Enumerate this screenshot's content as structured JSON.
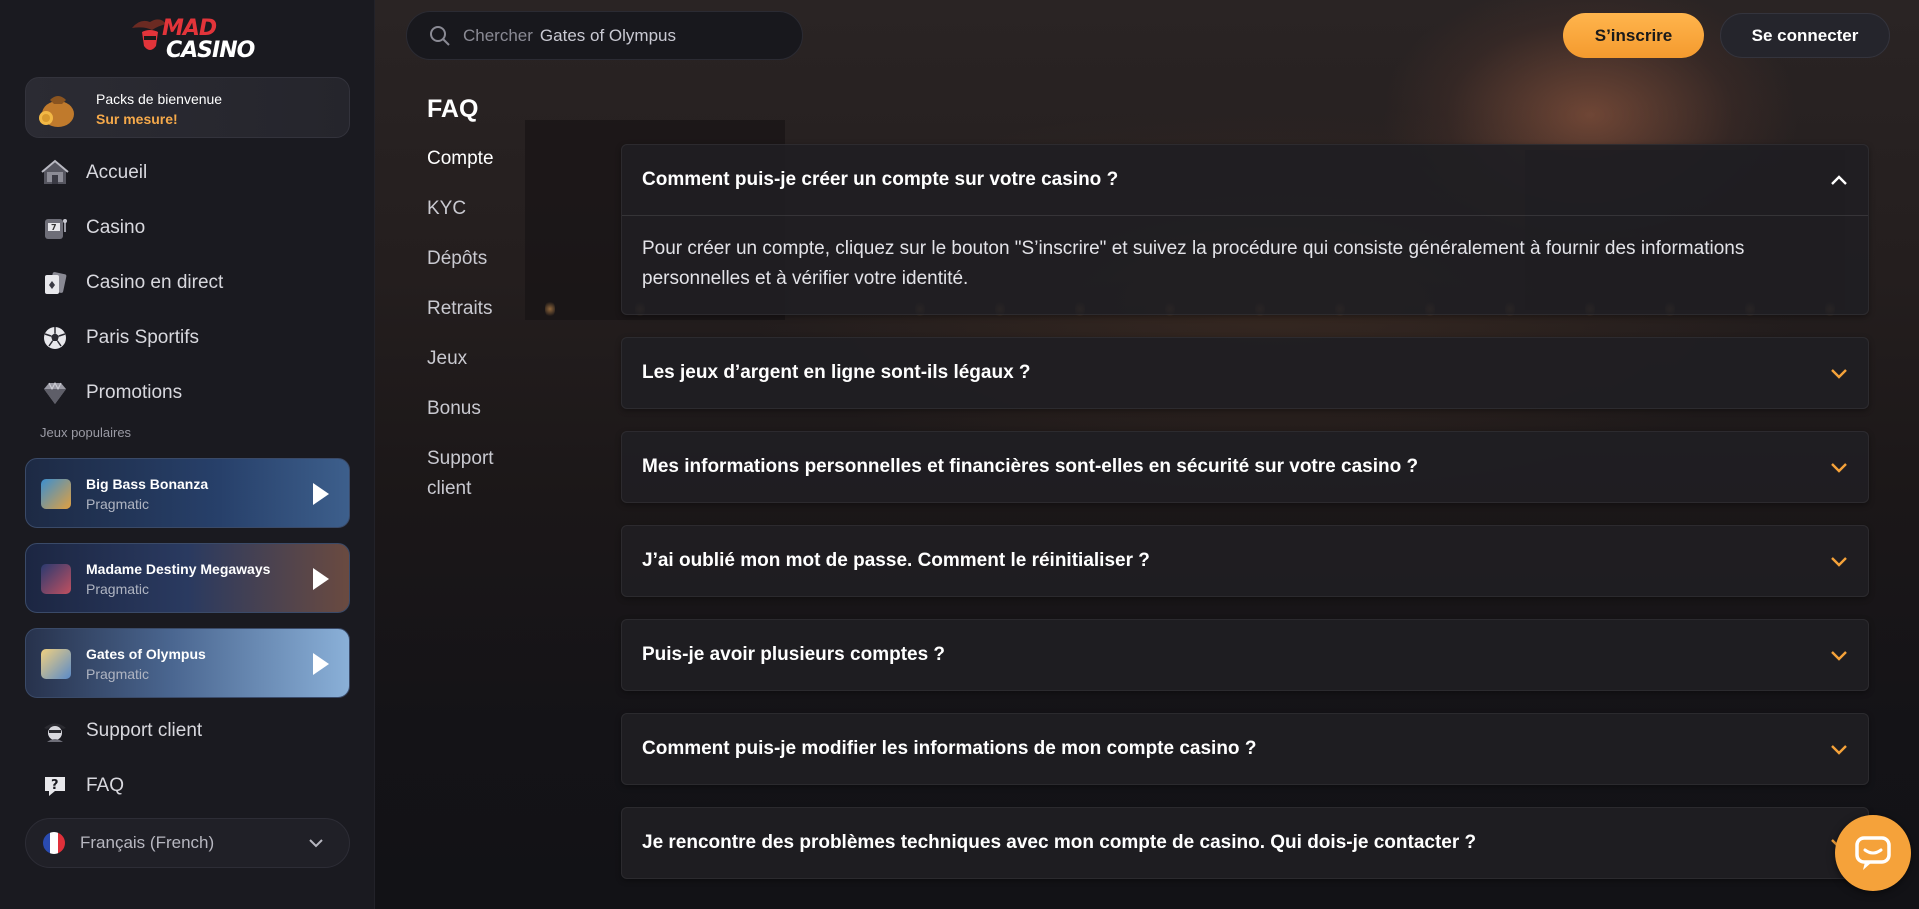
{
  "brand": {
    "line1": "MAD",
    "line2": "CASINO"
  },
  "welcome": {
    "title": "Packs de bienvenue",
    "subtitle": "Sur mesure!"
  },
  "nav": [
    {
      "label": "Accueil",
      "icon": "home-icon"
    },
    {
      "label": "Casino",
      "icon": "slot-machine-icon"
    },
    {
      "label": "Casino en direct",
      "icon": "cards-icon"
    },
    {
      "label": "Paris Sportifs",
      "icon": "soccer-ball-icon"
    },
    {
      "label": "Promotions",
      "icon": "diamond-icon"
    }
  ],
  "popular": {
    "label": "Jeux populaires",
    "games": [
      {
        "name": "Big Bass Bonanza",
        "provider": "Pragmatic"
      },
      {
        "name": "Madame Destiny Megaways",
        "provider": "Pragmatic"
      },
      {
        "name": "Gates of Olympus",
        "provider": "Pragmatic"
      }
    ]
  },
  "nav_bottom": [
    {
      "label": "Support client",
      "icon": "support-agent-icon"
    },
    {
      "label": "FAQ",
      "icon": "question-icon"
    }
  ],
  "language": {
    "label": "Français (French)"
  },
  "search": {
    "placeholder": "Chercher",
    "value": "Gates of Olympus"
  },
  "header": {
    "signup": "S’inscrire",
    "login": "Se connecter"
  },
  "faq": {
    "title": "FAQ",
    "categories": [
      "Compte",
      "KYC",
      "Dépôts",
      "Retraits",
      "Jeux",
      "Bonus",
      "Support client"
    ],
    "active_category": "Compte",
    "items": [
      {
        "question": "Comment puis-je créer un compte sur votre casino ?",
        "answer": "Pour créer un compte, cliquez sur le bouton \"S’inscrire\" et suivez la procédure qui consiste généralement à fournir des informations personnelles et à vérifier votre identité.",
        "expanded": true
      },
      {
        "question": "Les jeux d’argent en ligne sont-ils légaux ?",
        "expanded": false
      },
      {
        "question": "Mes informations personnelles et financières sont-elles en sécurité sur votre casino ?",
        "expanded": false
      },
      {
        "question": "J’ai oublié mon mot de passe. Comment le réinitialiser ?",
        "expanded": false
      },
      {
        "question": "Puis-je avoir plusieurs comptes ?",
        "expanded": false
      },
      {
        "question": "Comment puis-je modifier les informations de mon compte casino ?",
        "expanded": false
      },
      {
        "question": "Je rencontre des problèmes techniques avec mon compte de casino. Qui dois-je contacter ?",
        "expanded": false
      }
    ]
  },
  "colors": {
    "accent": "#f5a23a",
    "bg": "#141419",
    "sidebar": "#1a1a20"
  }
}
